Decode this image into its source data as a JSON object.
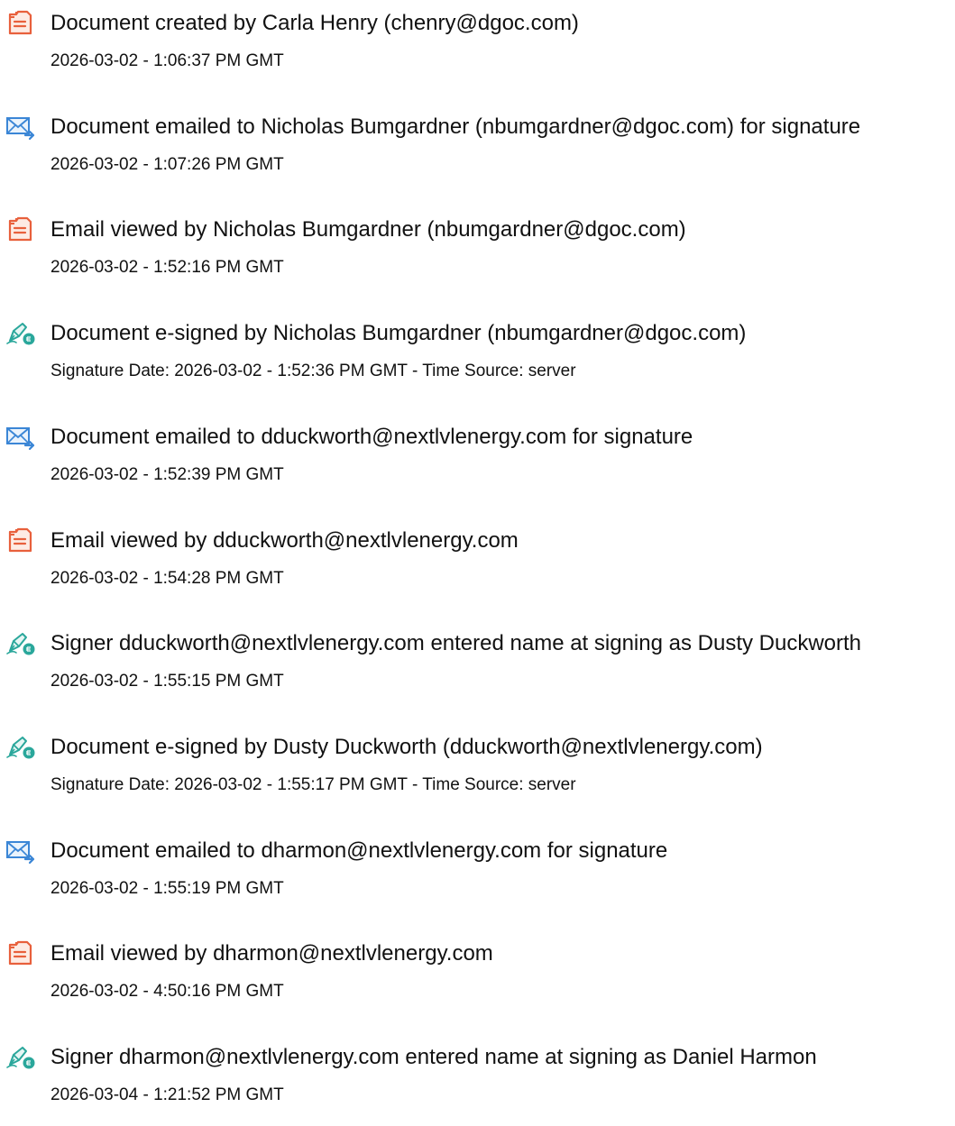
{
  "events": [
    {
      "icon": "document-created-icon",
      "title": "Document created by Carla Henry (chenry@dgoc.com)",
      "detail": "2026-03-02 - 1:06:37 PM GMT"
    },
    {
      "icon": "email-sent-icon",
      "title": "Document emailed to Nicholas Bumgardner (nbumgardner@dgoc.com) for signature",
      "detail": "2026-03-02 - 1:07:26 PM GMT"
    },
    {
      "icon": "document-viewed-icon",
      "title": "Email viewed by Nicholas Bumgardner (nbumgardner@dgoc.com)",
      "detail": "2026-03-02 - 1:52:16 PM GMT"
    },
    {
      "icon": "e-signature-icon",
      "title": "Document e-signed by Nicholas Bumgardner (nbumgardner@dgoc.com)",
      "detail": "Signature Date: 2026-03-02 - 1:52:36 PM GMT - Time Source: server"
    },
    {
      "icon": "email-sent-icon",
      "title": "Document emailed to dduckworth@nextlvlenergy.com for signature",
      "detail": "2026-03-02 - 1:52:39 PM GMT"
    },
    {
      "icon": "document-viewed-icon",
      "title": "Email viewed by dduckworth@nextlvlenergy.com",
      "detail": "2026-03-02 - 1:54:28 PM GMT"
    },
    {
      "icon": "e-signature-icon",
      "title": "Signer dduckworth@nextlvlenergy.com entered name at signing as Dusty Duckworth",
      "detail": "2026-03-02 - 1:55:15 PM GMT"
    },
    {
      "icon": "e-signature-icon",
      "title": "Document e-signed by Dusty Duckworth (dduckworth@nextlvlenergy.com)",
      "detail": "Signature Date: 2026-03-02 - 1:55:17 PM GMT - Time Source: server"
    },
    {
      "icon": "email-sent-icon",
      "title": "Document emailed to dharmon@nextlvlenergy.com for signature",
      "detail": "2026-03-02 - 1:55:19 PM GMT"
    },
    {
      "icon": "document-viewed-icon",
      "title": "Email viewed by dharmon@nextlvlenergy.com",
      "detail": "2026-03-02 - 4:50:16 PM GMT"
    },
    {
      "icon": "e-signature-icon",
      "title": "Signer dharmon@nextlvlenergy.com entered name at signing as Daniel Harmon",
      "detail": "2026-03-04 - 1:21:52 PM GMT"
    }
  ],
  "colors": {
    "document_icon": "#e8603c",
    "email_icon": "#3b86d6",
    "signature_icon": "#2aa79b",
    "text": "#111111"
  }
}
